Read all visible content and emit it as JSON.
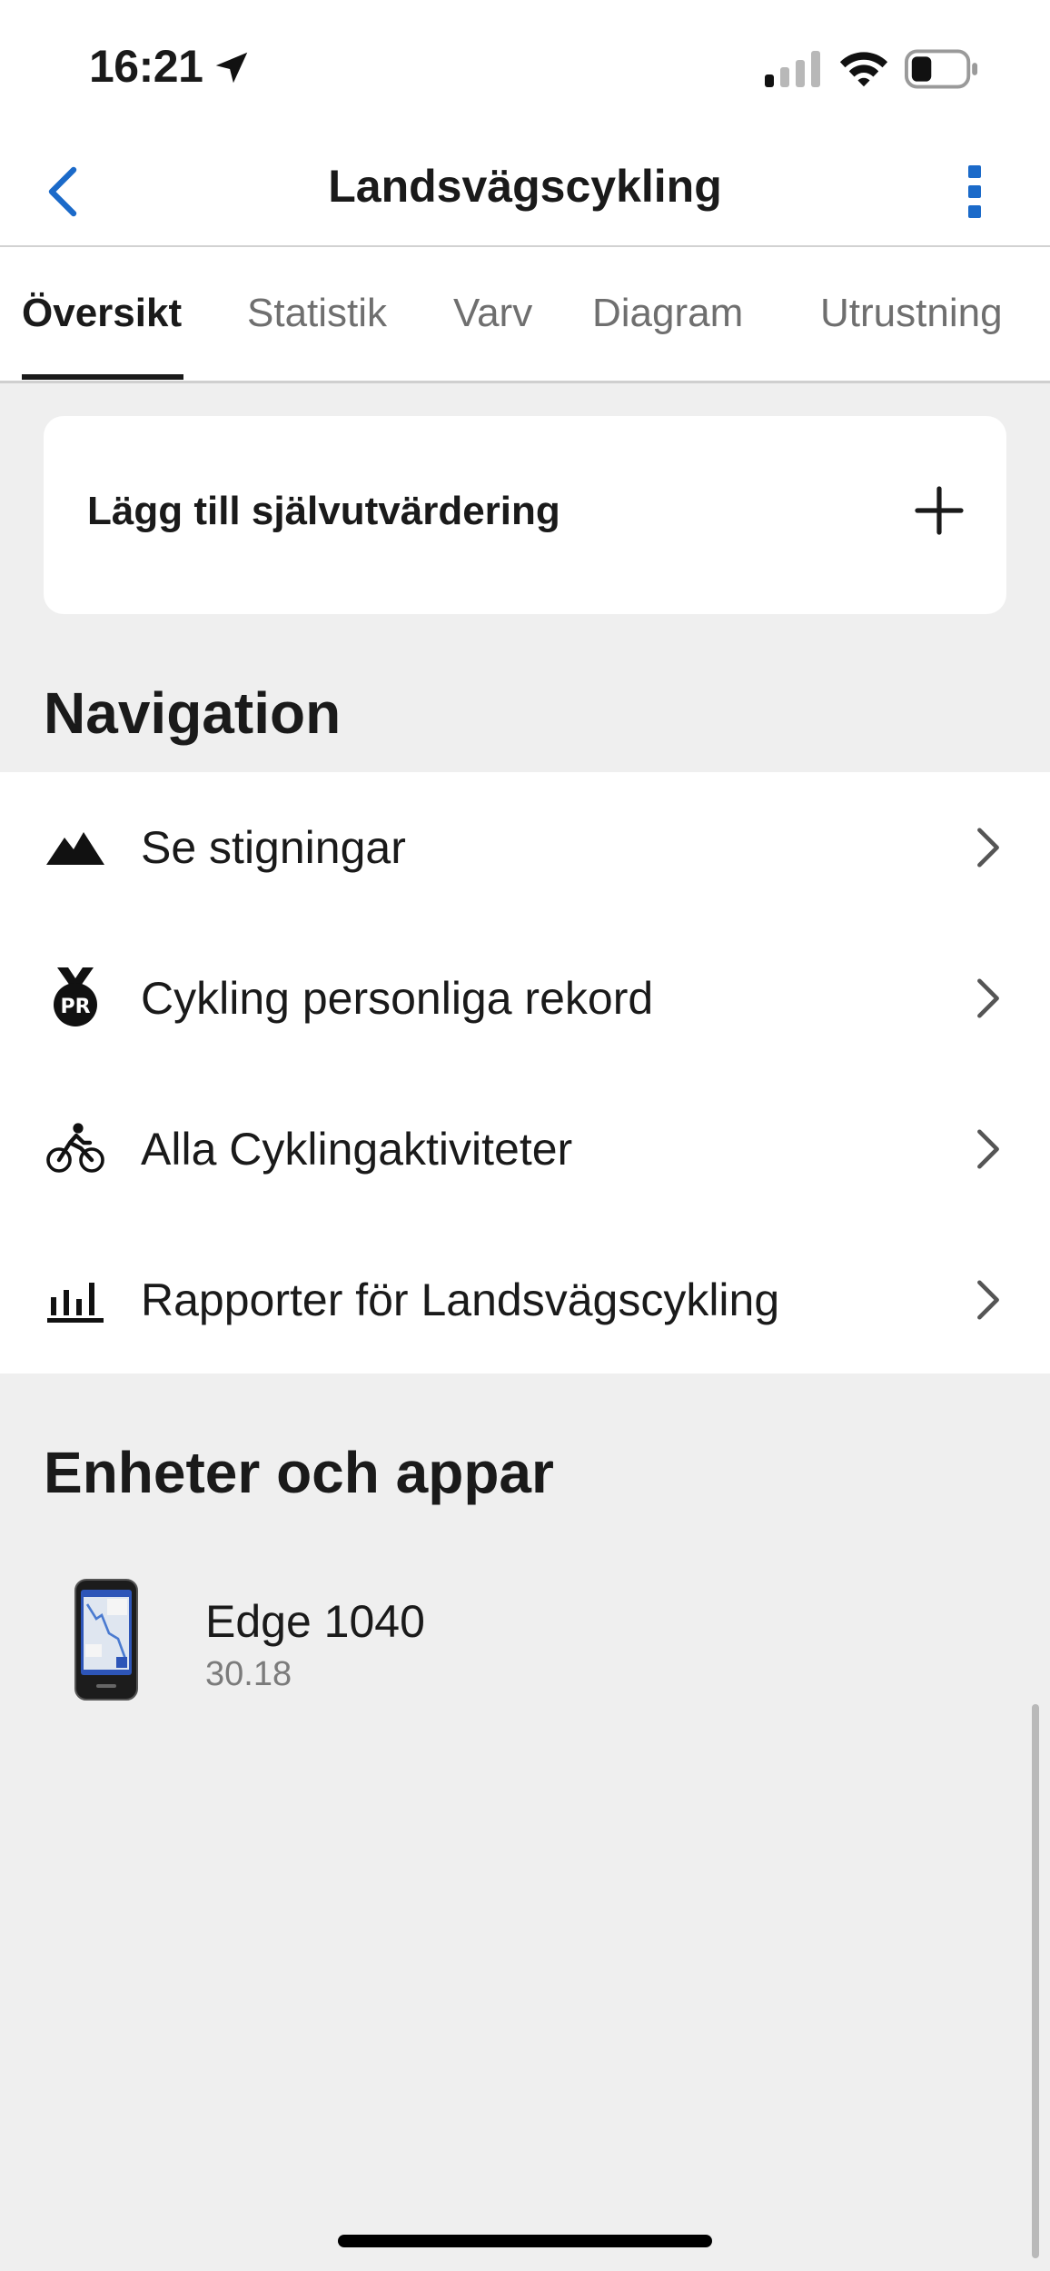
{
  "status_bar": {
    "time": "16:21",
    "icons": [
      "location-arrow-icon",
      "cellular-signal-icon",
      "wifi-icon",
      "battery-icon"
    ]
  },
  "header": {
    "title": "Landsvägscykling",
    "back_icon": "chevron-left-icon",
    "more_icon": "vertical-ellipsis-icon",
    "accent_color": "#1b6ac9"
  },
  "tabs": [
    {
      "label": "Översikt",
      "active": true
    },
    {
      "label": "Statistik",
      "active": false
    },
    {
      "label": "Varv",
      "active": false
    },
    {
      "label": "Diagram",
      "active": false
    },
    {
      "label": "Utrustning",
      "active": false
    }
  ],
  "self_evaluation": {
    "label": "Lägg till självutvärdering",
    "icon": "plus-icon"
  },
  "navigation": {
    "title": "Navigation",
    "items": [
      {
        "label": "Se stigningar",
        "icon": "mountain-icon"
      },
      {
        "label": "Cykling personliga rekord",
        "icon": "pr-medal-icon",
        "icon_text": "PR"
      },
      {
        "label": "Alla Cyklingaktiviteter",
        "icon": "cyclist-icon"
      },
      {
        "label": "Rapporter för Landsvägscykling",
        "icon": "bar-chart-icon"
      }
    ]
  },
  "devices": {
    "title": "Enheter och appar",
    "items": [
      {
        "name": "Edge 1040",
        "version": "30.18",
        "icon": "bike-computer-device-icon"
      }
    ]
  }
}
